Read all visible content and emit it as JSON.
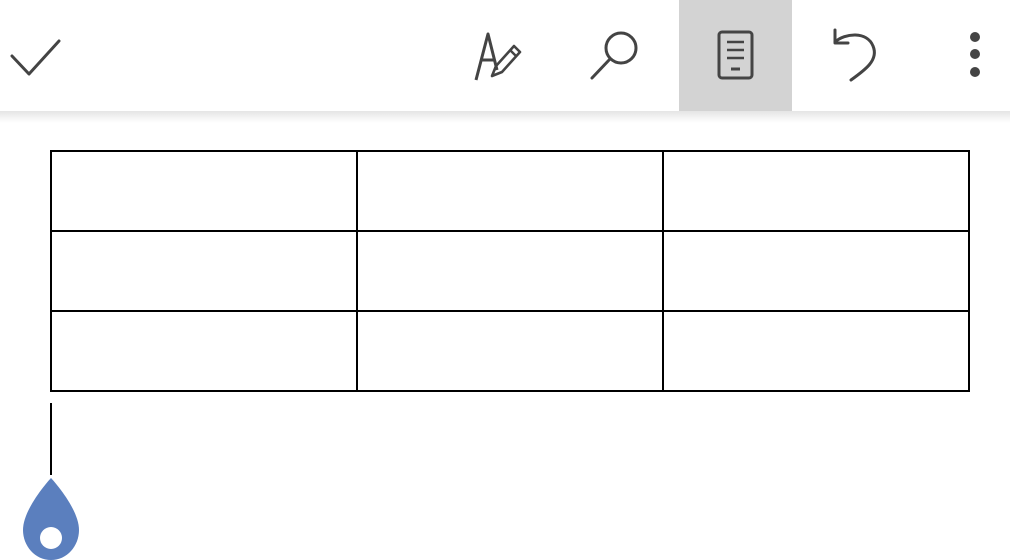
{
  "toolbar": {
    "buttons": [
      {
        "id": "done",
        "icon": "checkmark-icon",
        "active": false
      },
      {
        "id": "proofing",
        "icon": "spelling-pen-icon",
        "active": false
      },
      {
        "id": "find",
        "icon": "search-icon",
        "active": false
      },
      {
        "id": "mobile-view",
        "icon": "mobile-view-icon",
        "active": true
      },
      {
        "id": "undo",
        "icon": "undo-icon",
        "active": false
      },
      {
        "id": "more",
        "icon": "more-vertical-icon",
        "active": false
      }
    ],
    "active_color": "#d3d3d3",
    "icon_color": "#444444"
  },
  "document": {
    "table": {
      "rows": [
        [
          "",
          "",
          ""
        ],
        [
          "",
          "",
          ""
        ],
        [
          "",
          "",
          ""
        ]
      ]
    },
    "cursor_handle_color": "#5b7fbe"
  }
}
